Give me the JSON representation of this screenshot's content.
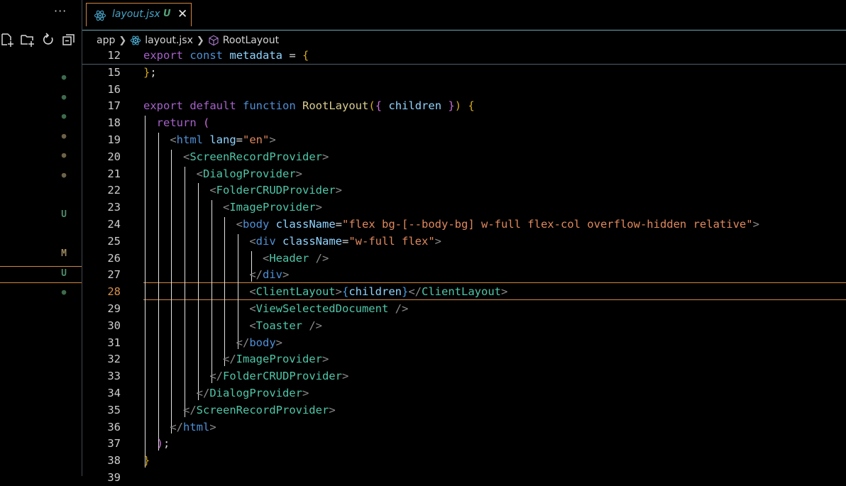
{
  "sidebar": {
    "more_label": "···",
    "actions": [
      "new-file-icon",
      "new-folder-icon",
      "refresh-icon",
      "collapse-all-icon"
    ],
    "statuses": [
      {
        "kind": "dot",
        "label": "●",
        "tone": "green"
      },
      {
        "kind": "dot",
        "label": "●",
        "tone": "green"
      },
      {
        "kind": "dot",
        "label": "●",
        "tone": "green"
      },
      {
        "kind": "dot",
        "label": "●",
        "tone": "modified"
      },
      {
        "kind": "dot",
        "label": "●",
        "tone": "modified"
      },
      {
        "kind": "dot",
        "label": "●",
        "tone": "modified"
      },
      {
        "kind": "text",
        "label": "U"
      },
      {
        "kind": "text",
        "label": "M"
      },
      {
        "kind": "text",
        "label": "U"
      },
      {
        "kind": "dot",
        "label": "●",
        "tone": "green"
      }
    ]
  },
  "tab": {
    "name": "layout.jsx",
    "badge": "U",
    "close": "✕"
  },
  "breadcrumb": {
    "items": [
      "app",
      "layout.jsx",
      "RootLayout"
    ]
  },
  "editor": {
    "current_line": "28",
    "lines": [
      {
        "n": "12",
        "tokens": [
          [
            "k",
            "export"
          ],
          [
            "p",
            " "
          ],
          [
            "kb",
            "const"
          ],
          [
            "p",
            " "
          ],
          [
            "v",
            "metadata"
          ],
          [
            "p",
            " = "
          ],
          [
            "br",
            "{"
          ]
        ]
      },
      {
        "n": "15",
        "tokens": [
          [
            "br",
            "}"
          ],
          [
            "p",
            ";"
          ]
        ]
      },
      {
        "n": "16",
        "tokens": []
      },
      {
        "n": "17",
        "tokens": [
          [
            "k",
            "export"
          ],
          [
            "p",
            " "
          ],
          [
            "k",
            "default"
          ],
          [
            "p",
            " "
          ],
          [
            "kb",
            "function"
          ],
          [
            "p",
            " "
          ],
          [
            "f",
            "RootLayout"
          ],
          [
            "br",
            "("
          ],
          [
            "br2",
            "{"
          ],
          [
            "p",
            " "
          ],
          [
            "v",
            "children"
          ],
          [
            "p",
            " "
          ],
          [
            "br2",
            "}"
          ],
          [
            "br",
            ")"
          ],
          [
            "p",
            " "
          ],
          [
            "br",
            "{"
          ]
        ]
      },
      {
        "n": "18",
        "tokens": [
          [
            "p",
            "  "
          ],
          [
            "k",
            "return"
          ],
          [
            "p",
            " "
          ],
          [
            "br2",
            "("
          ]
        ]
      },
      {
        "n": "19",
        "tokens": [
          [
            "p",
            "    "
          ],
          [
            "g",
            "<"
          ],
          [
            "tg",
            "html"
          ],
          [
            "p",
            " "
          ],
          [
            "a",
            "lang"
          ],
          [
            "p",
            "="
          ],
          [
            "s",
            "\"en\""
          ],
          [
            "g",
            ">"
          ]
        ]
      },
      {
        "n": "20",
        "tokens": [
          [
            "p",
            "      "
          ],
          [
            "g",
            "<"
          ],
          [
            "t",
            "ScreenRecordProvider"
          ],
          [
            "g",
            ">"
          ]
        ]
      },
      {
        "n": "21",
        "tokens": [
          [
            "p",
            "        "
          ],
          [
            "g",
            "<"
          ],
          [
            "t",
            "DialogProvider"
          ],
          [
            "g",
            ">"
          ]
        ]
      },
      {
        "n": "22",
        "tokens": [
          [
            "p",
            "          "
          ],
          [
            "g",
            "<"
          ],
          [
            "t",
            "FolderCRUDProvider"
          ],
          [
            "g",
            ">"
          ]
        ]
      },
      {
        "n": "23",
        "tokens": [
          [
            "p",
            "            "
          ],
          [
            "g",
            "<"
          ],
          [
            "t",
            "ImageProvider"
          ],
          [
            "g",
            ">"
          ]
        ]
      },
      {
        "n": "24",
        "tokens": [
          [
            "p",
            "              "
          ],
          [
            "g",
            "<"
          ],
          [
            "tg",
            "body"
          ],
          [
            "p",
            " "
          ],
          [
            "a",
            "className"
          ],
          [
            "p",
            "="
          ],
          [
            "s",
            "\"flex bg-[--body-bg] w-full flex-col overflow-hidden relative\""
          ],
          [
            "g",
            ">"
          ]
        ]
      },
      {
        "n": "25",
        "tokens": [
          [
            "p",
            "                "
          ],
          [
            "g",
            "<"
          ],
          [
            "tg",
            "div"
          ],
          [
            "p",
            " "
          ],
          [
            "a",
            "className"
          ],
          [
            "p",
            "="
          ],
          [
            "s",
            "\"w-full flex\""
          ],
          [
            "g",
            ">"
          ]
        ]
      },
      {
        "n": "26",
        "tokens": [
          [
            "p",
            "                  "
          ],
          [
            "g",
            "<"
          ],
          [
            "t",
            "Header"
          ],
          [
            "p",
            " "
          ],
          [
            "g",
            "/>"
          ]
        ]
      },
      {
        "n": "27",
        "tokens": [
          [
            "p",
            "                "
          ],
          [
            "g",
            "</"
          ],
          [
            "tg",
            "div"
          ],
          [
            "g",
            ">"
          ]
        ]
      },
      {
        "n": "28",
        "tokens": [
          [
            "p",
            "                "
          ],
          [
            "g",
            "<"
          ],
          [
            "t",
            "ClientLayout"
          ],
          [
            "g",
            ">"
          ],
          [
            "br3",
            "{"
          ],
          [
            "v",
            "children"
          ],
          [
            "br3",
            "}"
          ],
          [
            "g",
            "</"
          ],
          [
            "t",
            "ClientLayout"
          ],
          [
            "g",
            ">"
          ]
        ]
      },
      {
        "n": "29",
        "tokens": [
          [
            "p",
            "                "
          ],
          [
            "g",
            "<"
          ],
          [
            "t",
            "ViewSelectedDocument"
          ],
          [
            "p",
            " "
          ],
          [
            "g",
            "/>"
          ]
        ]
      },
      {
        "n": "30",
        "tokens": [
          [
            "p",
            "                "
          ],
          [
            "g",
            "<"
          ],
          [
            "t",
            "Toaster"
          ],
          [
            "p",
            " "
          ],
          [
            "g",
            "/>"
          ]
        ]
      },
      {
        "n": "31",
        "tokens": [
          [
            "p",
            "              "
          ],
          [
            "g",
            "</"
          ],
          [
            "tg",
            "body"
          ],
          [
            "g",
            ">"
          ]
        ]
      },
      {
        "n": "32",
        "tokens": [
          [
            "p",
            "            "
          ],
          [
            "g",
            "</"
          ],
          [
            "t",
            "ImageProvider"
          ],
          [
            "g",
            ">"
          ]
        ]
      },
      {
        "n": "33",
        "tokens": [
          [
            "p",
            "          "
          ],
          [
            "g",
            "</"
          ],
          [
            "t",
            "FolderCRUDProvider"
          ],
          [
            "g",
            ">"
          ]
        ]
      },
      {
        "n": "34",
        "tokens": [
          [
            "p",
            "        "
          ],
          [
            "g",
            "</"
          ],
          [
            "t",
            "DialogProvider"
          ],
          [
            "g",
            ">"
          ]
        ]
      },
      {
        "n": "35",
        "tokens": [
          [
            "p",
            "      "
          ],
          [
            "g",
            "</"
          ],
          [
            "t",
            "ScreenRecordProvider"
          ],
          [
            "g",
            ">"
          ]
        ]
      },
      {
        "n": "36",
        "tokens": [
          [
            "p",
            "    "
          ],
          [
            "g",
            "</"
          ],
          [
            "tg",
            "html"
          ],
          [
            "g",
            ">"
          ]
        ]
      },
      {
        "n": "37",
        "tokens": [
          [
            "p",
            "  "
          ],
          [
            "br2",
            ")"
          ],
          [
            "p",
            ";"
          ]
        ]
      },
      {
        "n": "38",
        "tokens": [
          [
            "br",
            "}"
          ]
        ]
      },
      {
        "n": "39",
        "tokens": []
      }
    ]
  },
  "colors": {
    "accent": "#d0853f",
    "tab_text": "#48a3c7",
    "untracked": "#55a07a"
  }
}
